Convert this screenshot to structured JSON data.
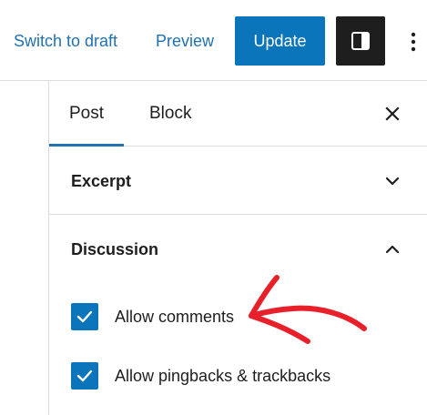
{
  "header": {
    "switch_to_draft": "Switch to draft",
    "preview": "Preview",
    "update": "Update"
  },
  "sidebar": {
    "tabs": [
      {
        "label": "Post",
        "active": true
      },
      {
        "label": "Block",
        "active": false
      }
    ],
    "sections": [
      {
        "title": "Excerpt",
        "expanded": false
      },
      {
        "title": "Discussion",
        "expanded": true,
        "options": [
          {
            "label": "Allow comments",
            "checked": true
          },
          {
            "label": "Allow pingbacks & trackbacks",
            "checked": true
          }
        ]
      }
    ]
  },
  "icons": {
    "sidebar_toggle": "sidebar-panel-icon",
    "more": "vertical-ellipsis-icon",
    "close": "close-x-icon",
    "collapsed": "chevron-down-icon",
    "expanded": "chevron-up-icon",
    "check": "checkmark-icon",
    "annotation": "red-arrow-icon"
  },
  "colors": {
    "accent": "#2271b1",
    "primary_button": "#0a75bb",
    "toggle_button": "#1e1e1e",
    "text": "#1e1e1e",
    "border": "#dcdcde",
    "annotation": "#e8202a"
  }
}
